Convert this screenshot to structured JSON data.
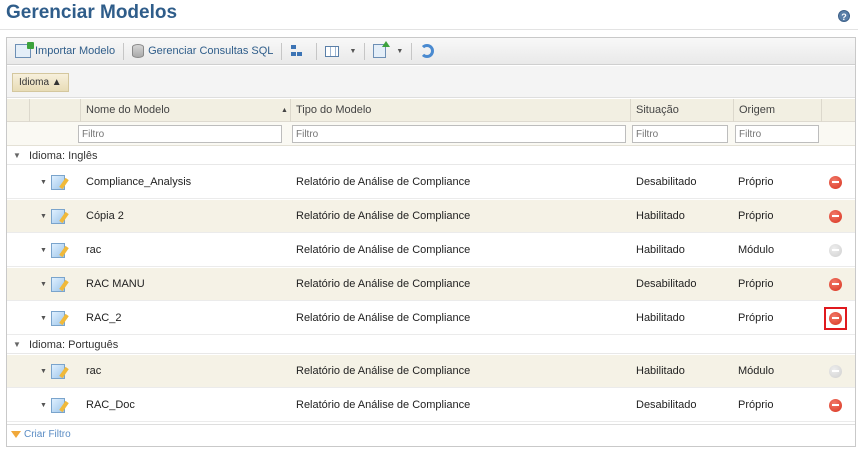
{
  "header": {
    "title": "Gerenciar Modelos",
    "help_icon": "help-icon"
  },
  "toolbar": {
    "import_label": "Importar Modelo",
    "sql_label": "Gerenciar Consultas SQL"
  },
  "grouping": {
    "chip_label": "Idioma ▲"
  },
  "columns": {
    "name": "Nome do Modelo",
    "type": "Tipo do Modelo",
    "status": "Situação",
    "origin": "Origem"
  },
  "filters": {
    "name_placeholder": "Filtro",
    "type_placeholder": "Filtro",
    "status_placeholder": "Filtro",
    "origin_placeholder": "Filtro"
  },
  "groups": [
    {
      "label": "Idioma: Inglês",
      "rows": [
        {
          "name": "Compliance_Analysis",
          "type": "Relatório de Análise de Compliance",
          "status": "Desabilitado",
          "origin": "Próprio",
          "delete_enabled": true
        },
        {
          "name": "Cópia 2",
          "type": "Relatório de Análise de Compliance",
          "status": "Habilitado",
          "origin": "Próprio",
          "delete_enabled": true
        },
        {
          "name": "rac",
          "type": "Relatório de Análise de Compliance",
          "status": "Habilitado",
          "origin": "Módulo",
          "delete_enabled": false
        },
        {
          "name": "RAC MANU",
          "type": "Relatório de Análise de Compliance",
          "status": "Desabilitado",
          "origin": "Próprio",
          "delete_enabled": true
        },
        {
          "name": "RAC_2",
          "type": "Relatório de Análise de Compliance",
          "status": "Habilitado",
          "origin": "Próprio",
          "delete_enabled": true,
          "highlighted": true
        }
      ]
    },
    {
      "label": "Idioma: Português",
      "rows": [
        {
          "name": "rac",
          "type": "Relatório de Análise de Compliance",
          "status": "Habilitado",
          "origin": "Módulo",
          "delete_enabled": false
        },
        {
          "name": "RAC_Doc",
          "type": "Relatório de Análise de Compliance",
          "status": "Desabilitado",
          "origin": "Próprio",
          "delete_enabled": true
        }
      ]
    }
  ],
  "footer": {
    "create_filter_label": "Criar Filtro"
  },
  "colors": {
    "title": "#2f5d8a",
    "delete": "#d8331f",
    "highlight": "#e0191e",
    "alt_row": "#f5f2e6"
  }
}
